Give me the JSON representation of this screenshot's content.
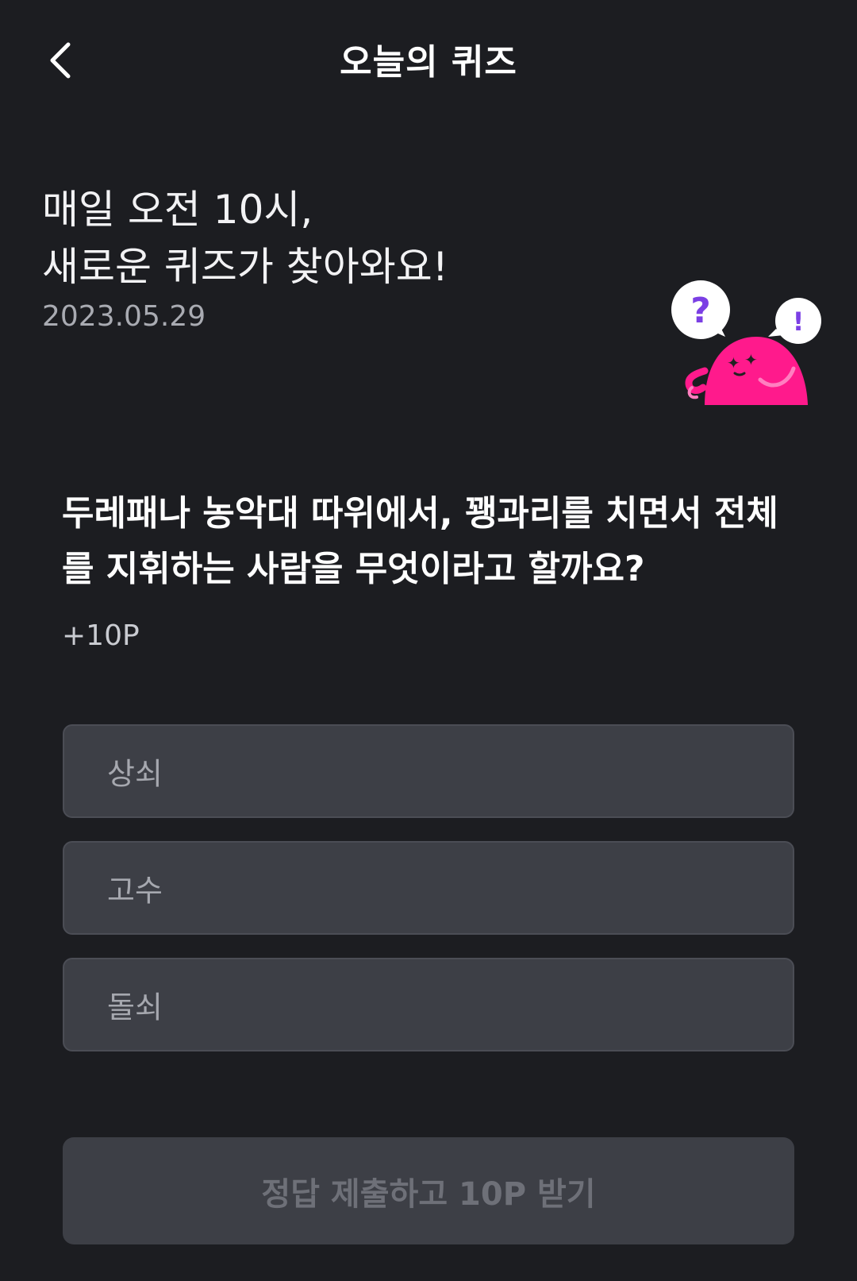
{
  "header": {
    "title": "오늘의 퀴즈",
    "back_icon": "chevron-left-icon"
  },
  "intro": {
    "line1": "매일 오전 10시,",
    "line2": "새로운 퀴즈가 찾아와요!",
    "date": "2023.05.29"
  },
  "mascot": {
    "bubble_left": "?",
    "bubble_right": "!",
    "color": "#ff1a8c",
    "accent": "#7b3fe4"
  },
  "quiz": {
    "question_line1": "두레패나 농악대 따위에서, 꽹과리를 치면서 전체",
    "question_line2": "를 지휘하는 사람을 무엇이라고 할까요?",
    "points": "+10P",
    "options": [
      {
        "label": "상쇠"
      },
      {
        "label": "고수"
      },
      {
        "label": "돌쇠"
      }
    ]
  },
  "submit": {
    "label": "정답 제출하고 10P 받기"
  },
  "colors": {
    "background": "#1c1d21",
    "option_bg": "#3d3f46",
    "pink": "#ff1a8c"
  }
}
